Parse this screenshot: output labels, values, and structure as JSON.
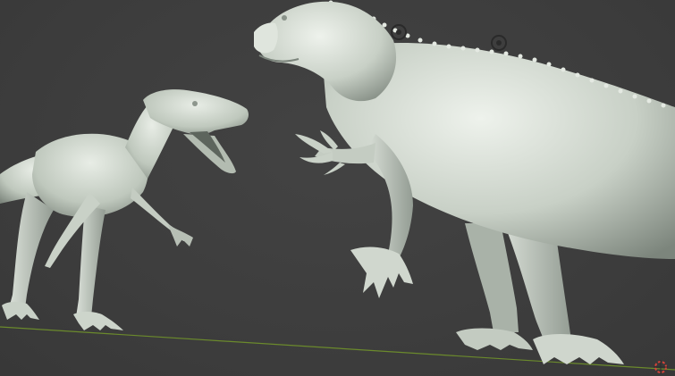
{
  "viewport": {
    "background": "#3d3d3d",
    "grid_line_color": "#4a4a4a",
    "x_axis_color": "#6b8a2c",
    "sculpt_color_light": "#e6ebe4",
    "sculpt_color_mid": "#b9c2b8",
    "sculpt_color_dark": "#7c857c"
  },
  "objects": {
    "small_dinosaur": {
      "icon": "dinosaur-model-icon"
    },
    "large_dinosaur": {
      "icon": "dinosaur-model-icon"
    }
  },
  "overlays": {
    "origin_markers": [
      "object-origin-icon",
      "object-origin-icon"
    ],
    "cursor": "3d-cursor-icon"
  }
}
